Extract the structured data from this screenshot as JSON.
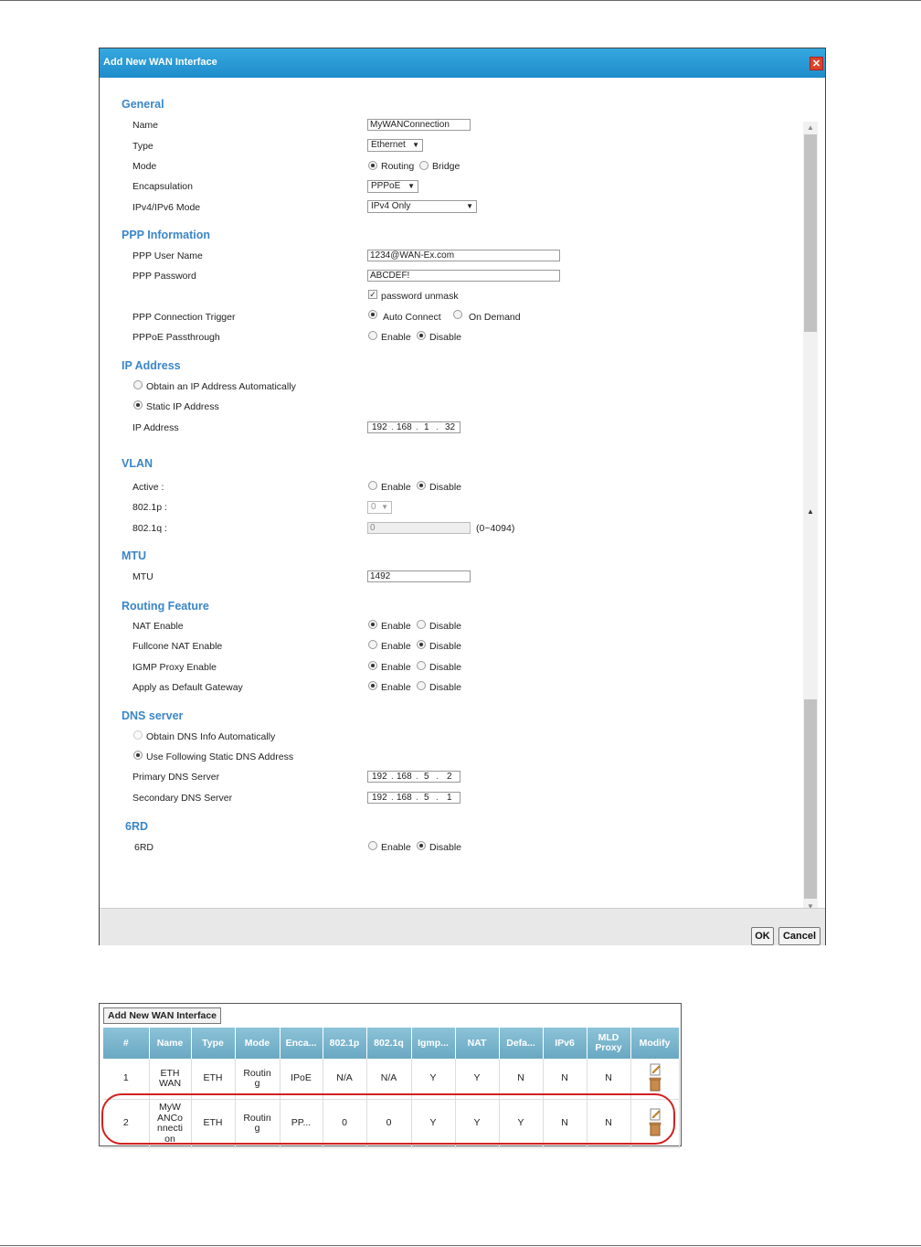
{
  "dialog": {
    "title": "Add New WAN Interface",
    "close_label": "✕",
    "ok_label": "OK",
    "cancel_label": "Cancel"
  },
  "general": {
    "heading": "General",
    "name_label": "Name",
    "name_value": "MyWANConnection",
    "type_label": "Type",
    "type_value": "Ethernet",
    "mode_label": "Mode",
    "mode_routing": "Routing",
    "mode_bridge": "Bridge",
    "encap_label": "Encapsulation",
    "encap_value": "PPPoE",
    "ipmode_label": "IPv4/IPv6 Mode",
    "ipmode_value": "IPv4 Only"
  },
  "ppp": {
    "heading": "PPP Information",
    "user_label": "PPP User Name",
    "user_value": "1234@WAN-Ex.com",
    "pass_label": "PPP Password",
    "pass_value": "ABCDEF!",
    "unmask_label": "password unmask",
    "trigger_label": "PPP Connection Trigger",
    "trigger_auto": "Auto Connect",
    "trigger_demand": "On Demand",
    "passthrough_label": "PPPoE Passthrough",
    "enable": "Enable",
    "disable": "Disable"
  },
  "ip": {
    "heading": "IP Address",
    "auto_label": "Obtain an IP Address Automatically",
    "static_label": "Static IP Address",
    "address_label": "IP Address",
    "octets": [
      "192",
      "168",
      "1",
      "32"
    ]
  },
  "vlan": {
    "heading": "VLAN",
    "active_label": "Active :",
    "enable": "Enable",
    "disable": "Disable",
    "p_label": "802.1p :",
    "p_value": "0",
    "q_label": "802.1q :",
    "q_value": "0",
    "q_range": "(0~4094)"
  },
  "mtu": {
    "heading": "MTU",
    "label": "MTU",
    "value": "1492"
  },
  "routing": {
    "heading": "Routing Feature",
    "nat_label": "NAT Enable",
    "fullcone_label": "Fullcone NAT Enable",
    "igmp_label": "IGMP Proxy Enable",
    "gateway_label": "Apply as Default Gateway",
    "enable": "Enable",
    "disable": "Disable"
  },
  "dns": {
    "heading": "DNS server",
    "auto_label": "Obtain DNS Info Automatically",
    "static_label": "Use Following Static DNS Address",
    "primary_label": "Primary DNS Server",
    "primary": [
      "192",
      "168",
      "5",
      "2"
    ],
    "secondary_label": "Secondary DNS Server",
    "secondary": [
      "192",
      "168",
      "5",
      "1"
    ]
  },
  "sixrd": {
    "heading": "6RD",
    "label": "6RD",
    "enable": "Enable",
    "disable": "Disable"
  },
  "table": {
    "add_label": "Add New WAN Interface",
    "headers": [
      "#",
      "Name",
      "Type",
      "Mode",
      "Enca...",
      "802.1p",
      "802.1q",
      "Igmp...",
      "NAT",
      "Defa...",
      "IPv6",
      "MLD Proxy",
      "Modify"
    ],
    "rows": [
      [
        "1",
        "ETH WAN",
        "ETH",
        "Routin g",
        "IPoE",
        "N/A",
        "N/A",
        "Y",
        "Y",
        "N",
        "N",
        "N"
      ],
      [
        "2",
        "MyW ANCo nnecti on",
        "ETH",
        "Routin g",
        "PP...",
        "0",
        "0",
        "Y",
        "Y",
        "Y",
        "N",
        "N"
      ]
    ]
  },
  "icons": {
    "modify": "edit-icon",
    "delete": "trash-icon"
  },
  "colors": {
    "title_bar": "#2f9fd6",
    "section_heading": "#3a86c8",
    "table_header": "#7fb8cf",
    "highlight": "#d32020"
  }
}
